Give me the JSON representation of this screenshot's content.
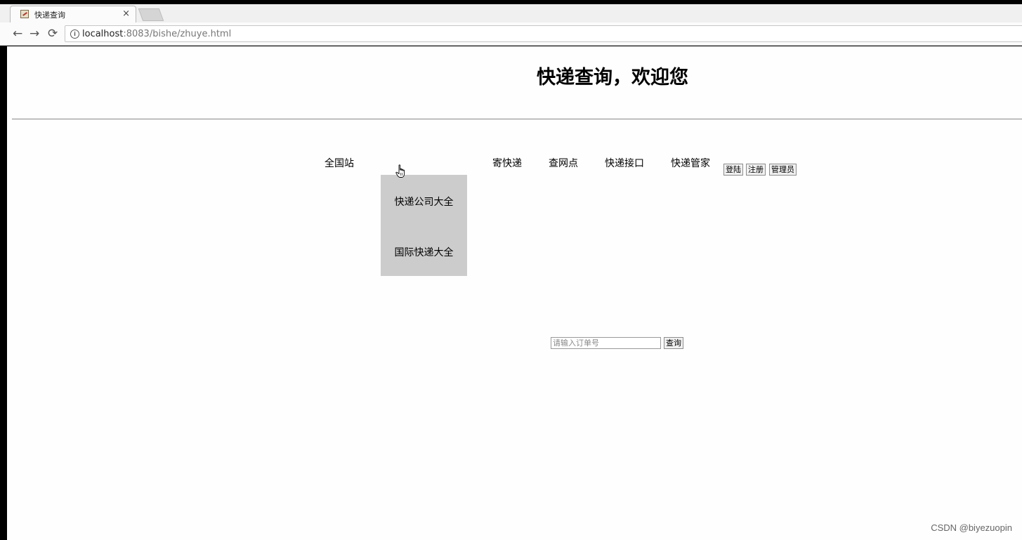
{
  "browser": {
    "tab_title": "快递查询",
    "tab_close": "×",
    "nav": {
      "back": "←",
      "forward": "→",
      "reload": "⟳"
    },
    "url_host": "localhost",
    "url_path": ":8083/bishe/zhuye.html"
  },
  "page": {
    "title": "快递查询，欢迎您",
    "nav_items": [
      "全国站",
      "寄快递",
      "查网点",
      "快递接口",
      "快递管家"
    ],
    "dropdown_items": [
      "快递公司大全",
      "国际快递大全"
    ],
    "buttons": {
      "login": "登陆",
      "register": "注册",
      "admin": "管理员"
    },
    "search": {
      "placeholder": "请输入订单号",
      "button": "查询"
    }
  },
  "watermark": "CSDN @biyezuopin"
}
